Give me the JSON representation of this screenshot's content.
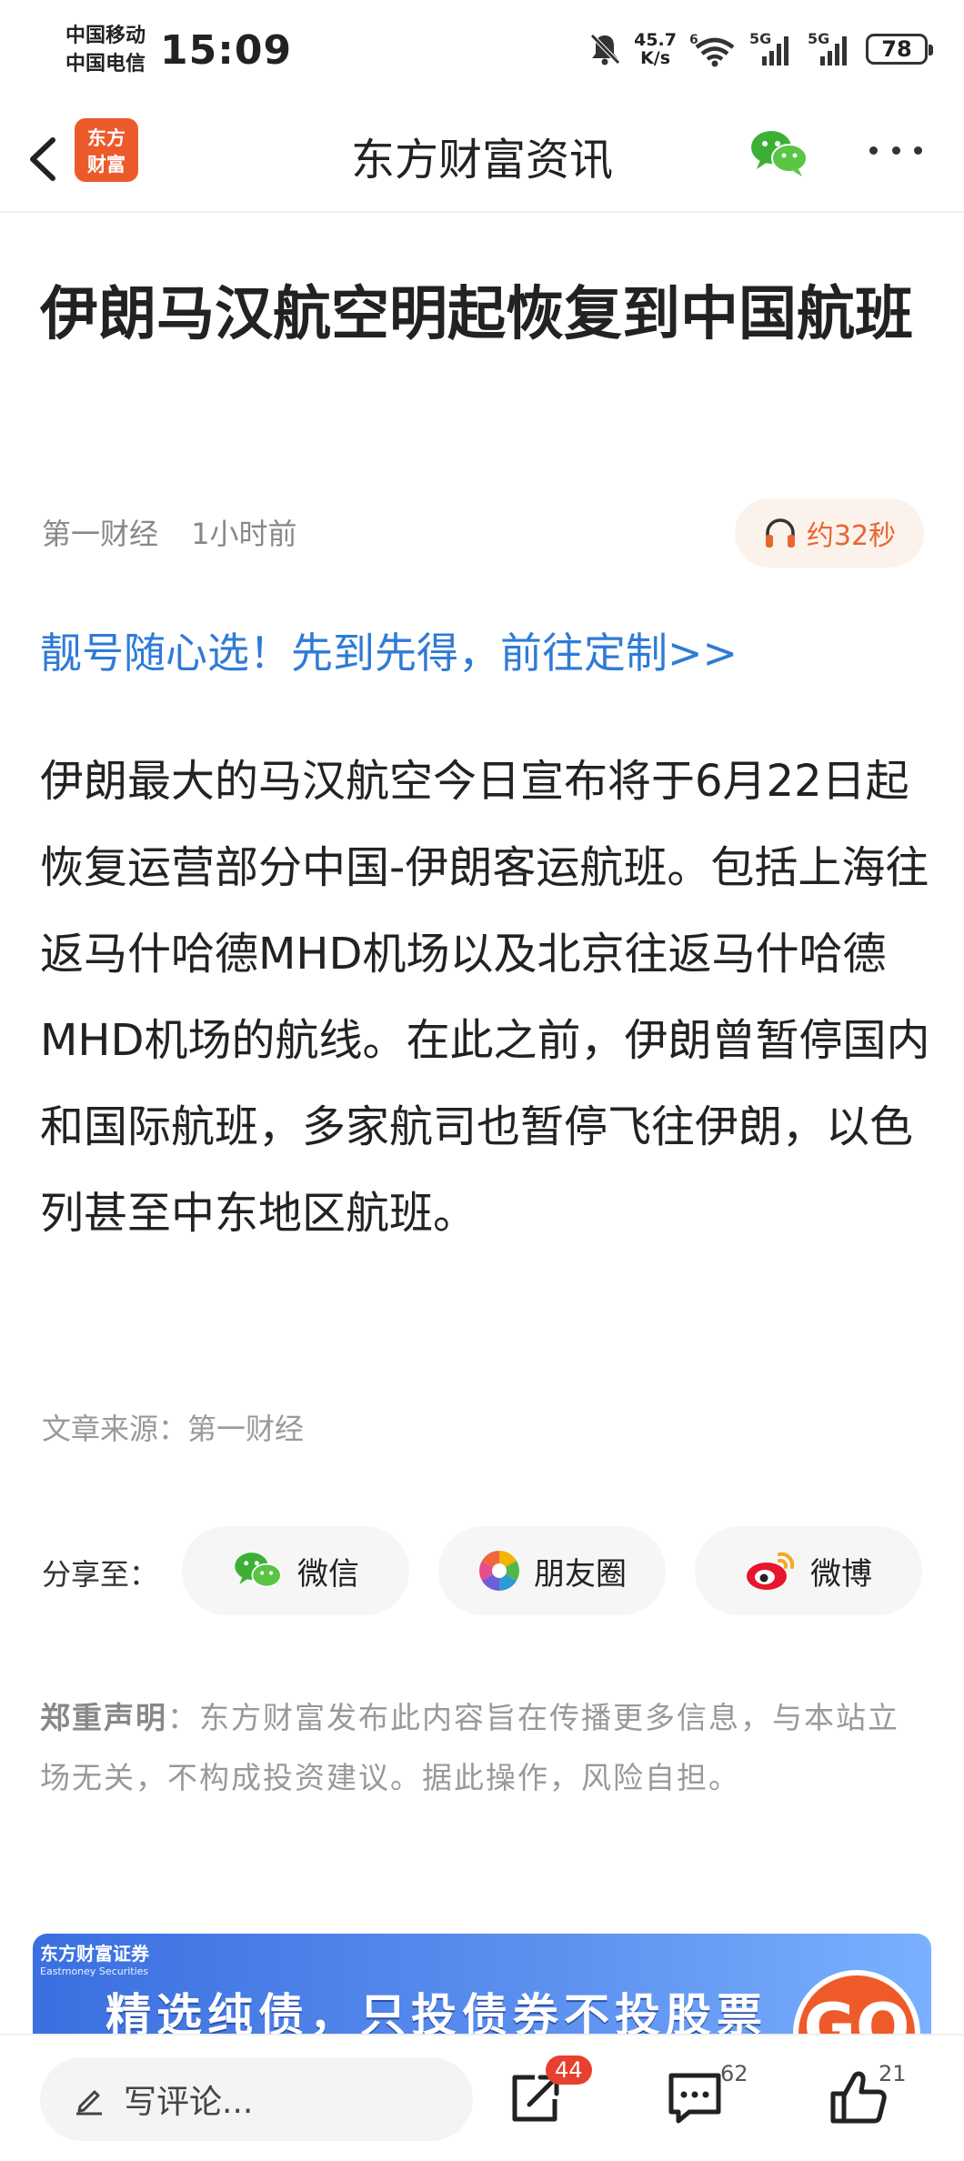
{
  "status_bar": {
    "carrier_1": "中国移动",
    "carrier_2": "中国电信",
    "time": "15:09",
    "net_speed_value": "45.7",
    "net_speed_unit": "K/s",
    "signal_1_label": "5G",
    "signal_2_label": "5G",
    "wifi_label": "6",
    "battery": "78",
    "icons": [
      "mute-bell-icon",
      "wifi-icon",
      "signal-icon",
      "signal-icon",
      "battery-icon"
    ]
  },
  "nav": {
    "app_logo_line_1": "东方",
    "app_logo_line_2": "财富",
    "title": "东方财富资讯",
    "icons": [
      "back-chevron-icon",
      "wechat-icon",
      "more-dots-icon"
    ]
  },
  "article": {
    "title": "伊朗马汉航空明起恢复到中国航班",
    "source_name": "第一财经",
    "time_ago": "1小时前",
    "audio_label": "约32秒",
    "promo_link": "靓号随心选！先到先得，前往定制>>",
    "body": "伊朗最大的马汉航空今日宣布将于6月22日起恢复运营部分中国-伊朗客运航班。包括上海往返马什哈德MHD机场以及北京往返马什哈德MHD机场的航线。在此之前，伊朗曾暂停国内和国际航班，多家航司也暂停飞往伊朗，以色列甚至中东地区航班。",
    "source_line": "文章来源：第一财经"
  },
  "share": {
    "label": "分享至：",
    "wechat": "微信",
    "moments": "朋友圈",
    "weibo": "微博"
  },
  "disclaimer": {
    "heading": "郑重声明",
    "text": "：东方财富发布此内容旨在传播更多信息，与本站立场无关，不构成投资建议。据此操作，风险自担。"
  },
  "banner": {
    "brand": "东方财富证券",
    "brand_en": "Eastmoney Securities",
    "slogan": "精选纯债，只投债券不投股票",
    "go": "GO"
  },
  "bottom_bar": {
    "comment_placeholder": "写评论...",
    "share_count": "44",
    "comment_count": "62",
    "like_count": "21"
  },
  "colors": {
    "accent_orange": "#ec5a2b",
    "link_blue": "#2f7bd6",
    "wechat_green": "#3cb034",
    "badge_red": "#e8402e"
  }
}
